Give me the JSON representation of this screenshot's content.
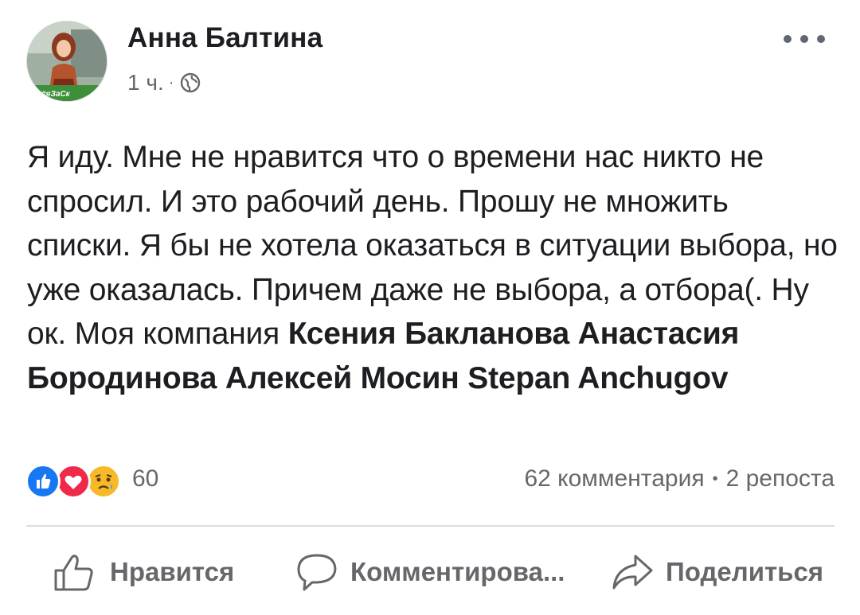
{
  "post": {
    "author": {
      "name": "Анна Балтина",
      "avatar_frame_label": "#яЗаСк"
    },
    "time": "1 ч.",
    "separator": "·",
    "privacy_icon": "globe-icon",
    "more_icon": "more-horizontal-icon",
    "text_plain": "Я иду. Мне не нравится что о времени нас никто не спросил. И это рабочий день. Прошу не множить списки. Я бы не хотела оказаться в ситуации выбора, но уже оказалась. Причем даже не выбора, а отбора(. Ну ок. Моя компания ",
    "tagged_people": [
      "Ксения Бакланова",
      "Анастасия Бородинова",
      "Алексей Мосин",
      "Stepan Anchugov"
    ],
    "reactions": {
      "icons": [
        "like-icon",
        "love-icon",
        "sad-icon"
      ],
      "count": "60",
      "colors": {
        "like": "#1877f2",
        "love": "#f0284a",
        "sad": "#f7b928"
      }
    },
    "stats": {
      "comments": "62 комментария",
      "separator": "•",
      "shares": "2 репоста"
    },
    "actions": {
      "like_label": "Нравится",
      "comment_label": "Комментирова...",
      "share_label": "Поделиться"
    }
  },
  "colors": {
    "text": "#1c1e21",
    "secondary": "#65676b",
    "divider": "#dadde1"
  }
}
